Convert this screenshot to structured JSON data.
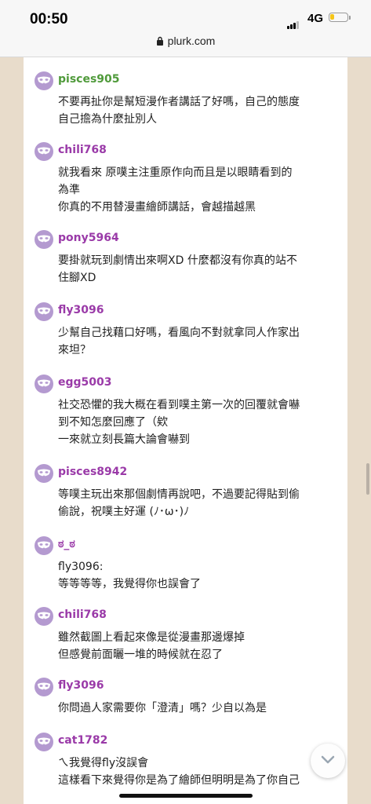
{
  "status": {
    "time": "00:50",
    "network": "4G",
    "battery_level": 0.25
  },
  "browser": {
    "url": "plurk.com"
  },
  "comments": [
    {
      "user": "pisces905",
      "color": "#4f9a3a",
      "lines": [
        "不要再扯你是幫短漫作者講話了好嗎，自己的態度",
        "自己擔為什麼扯別人"
      ]
    },
    {
      "user": "chili768",
      "color": "#9a3aa8",
      "lines": [
        "就我看來 原噗主注重原作向而且是以眼睛看到的",
        "為準",
        "你真的不用替漫畫繪師講話，會越描越黑"
      ]
    },
    {
      "user": "pony5964",
      "color": "#9a3aa8",
      "lines": [
        "要掛就玩到劇情出來啊XD 什麼都沒有你真的站不",
        "住腳XD"
      ]
    },
    {
      "user": "fly3096",
      "color": "#9a3aa8",
      "lines": [
        "少幫自己找藉口好嗎，看風向不對就拿同人作家出",
        "來坦？"
      ]
    },
    {
      "user": "egg5003",
      "color": "#9a3aa8",
      "lines": [
        "社交恐懼的我大概在看到噗主第一次的回覆就會嚇",
        "到不知怎麼回應了（欸",
        "一來就立刻長篇大論會嚇到"
      ]
    },
    {
      "user": "pisces8942",
      "color": "#9a3aa8",
      "lines": [
        "等噗主玩出來那個劇情再說吧，不過要記得貼到偷",
        "偷說，祝噗主好運 (ﾉ･ω･)ﾉ"
      ]
    },
    {
      "user": "ಠ_ಠ",
      "color": "#9a3aa8",
      "lines": [
        "fly3096:",
        "等等等等，我覺得你也誤會了"
      ]
    },
    {
      "user": "chili768",
      "color": "#9a3aa8",
      "lines": [
        "雖然截圖上看起來像是從漫畫那邊爆掉",
        "但感覺前面曬一堆的時候就在忍了"
      ]
    },
    {
      "user": "fly3096",
      "color": "#9a3aa8",
      "lines": [
        "你問過人家需要你「澄清」嗎？少自以為是"
      ]
    },
    {
      "user": "cat1782",
      "color": "#9a3aa8",
      "lines": [
        "ㄟ我覺得fly沒誤會",
        "這樣看下來覺得你是為了繪師但明明是為了你自己"
      ]
    }
  ],
  "icons": {
    "avatar": "mask-icon",
    "scroll_down": "chevron-down-icon",
    "lock": "lock-icon"
  }
}
